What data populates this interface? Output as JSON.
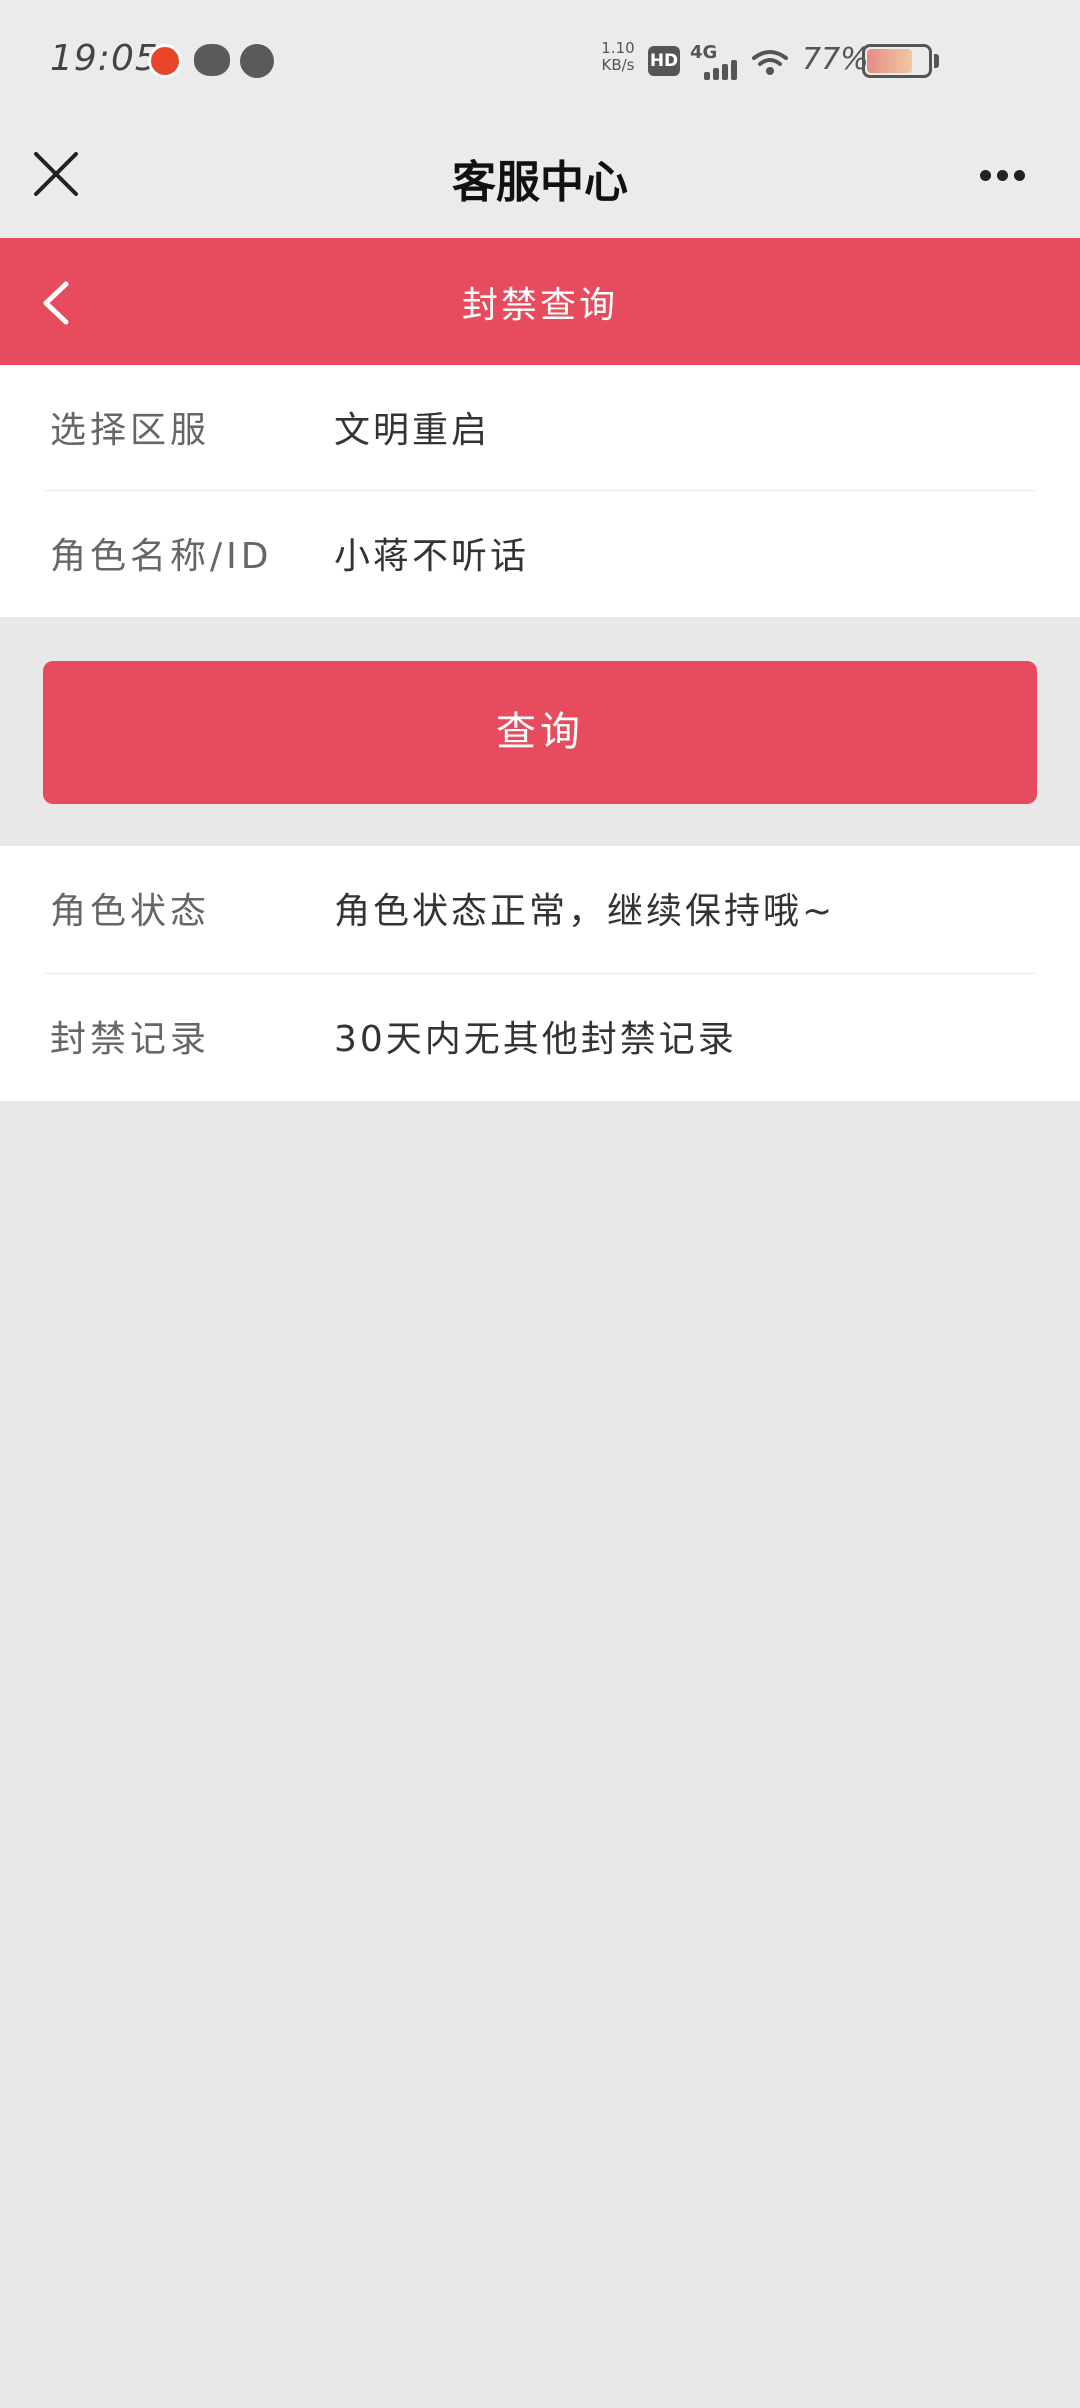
{
  "status_bar": {
    "time": "19:05",
    "net_speed_value": "1.10",
    "net_speed_unit": "KB/s",
    "hd_label": "HD",
    "network_label": "4G",
    "battery_percent": "77%",
    "battery_level": 0.77
  },
  "titlebar": {
    "title": "客服中心",
    "close_icon": "close-icon",
    "more_icon": "more-dots-icon"
  },
  "header": {
    "title": "封禁查询",
    "back_icon": "chevron-left-icon",
    "color": "#e64c5d"
  },
  "form": {
    "server_label": "选择区服",
    "server_value": "文明重启",
    "role_label": "角色名称/ID",
    "role_value": "小蒋不听话"
  },
  "query_button": {
    "label": "查询",
    "color": "#e64c5d"
  },
  "result": {
    "status_label": "角色状态",
    "status_value": "角色状态正常，继续保持哦~",
    "record_label": "封禁记录",
    "record_value": "30天内无其他封禁记录"
  }
}
